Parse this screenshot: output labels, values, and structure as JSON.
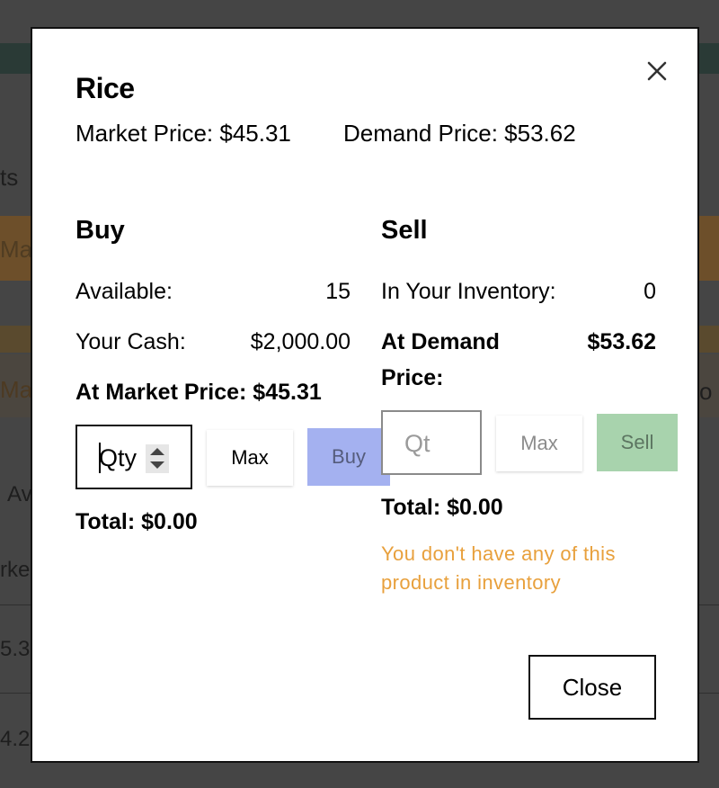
{
  "modal": {
    "title": "Rice",
    "market_price_line": "Market Price: $45.31",
    "demand_price_line": "Demand Price: $53.62",
    "close_label": "Close"
  },
  "buy": {
    "title": "Buy",
    "available_label": "Available:",
    "available_value": "15",
    "cash_label": "Your Cash:",
    "cash_value": "$2,000.00",
    "price_label": "At Market Price: $45.31",
    "qty_placeholder": "Qty",
    "max_label": "Max",
    "buy_label": "Buy",
    "total": "Total: $0.00"
  },
  "sell": {
    "title": "Sell",
    "inventory_label": "In Your Inventory:",
    "inventory_value": "0",
    "price_label_1": "At Demand",
    "price_label_2": "Price:",
    "price_value": "$53.62",
    "qty_placeholder": "Qt",
    "max_label": "Max",
    "sell_label": "Sell",
    "total": "Total: $0.00",
    "warning": "You don't have any of this product in inventory"
  },
  "background": {
    "text_1": "ts",
    "text_2": "Ma",
    "text_3": "Ma",
    "text_4": "Av",
    "text_5": "rke",
    "text_6": "5.3",
    "text_7": "4.2",
    "text_8": "o"
  },
  "colors": {
    "overlay": "#454545",
    "buy_button": "#a4b1f0",
    "sell_button": "#a8d3ad",
    "warning": "#e8a03c"
  }
}
